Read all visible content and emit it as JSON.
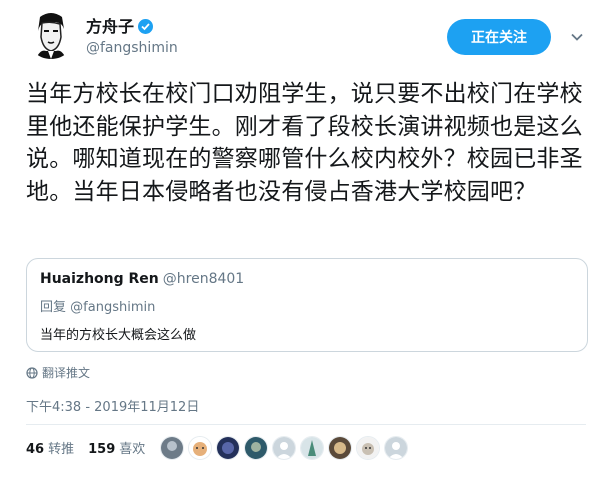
{
  "author": {
    "name": "方舟子",
    "handle": "@fangshimin",
    "verified_color": "#1da1f2"
  },
  "follow_button": {
    "label": "正在关注",
    "color": "#1da1f2"
  },
  "tweet": {
    "text": "当年方校长在校门口劝阻学生，说只要不出校门在学校里他还能保护学生。刚才看了段校长演讲视频也是这么说。哪知道现在的警察哪管什么校内校外？校园已非圣地。当年日本侵略者也没有侵占香港大学校园吧？",
    "translate_label": "翻译推文",
    "timestamp": "下午4:38 - 2019年11月12日"
  },
  "quoted_tweet": {
    "name": "Huaizhong Ren",
    "handle": "@hren8401",
    "reply_prefix": "回复",
    "reply_to": "@fangshimin",
    "text": "当年的方校长大概会这么做"
  },
  "stats": {
    "retweets_count": "46",
    "retweets_label": "转推",
    "likes_count": "159",
    "likes_label": "喜欢"
  },
  "likers": [
    {
      "icon": "avatar-1"
    },
    {
      "icon": "avatar-2"
    },
    {
      "icon": "avatar-3"
    },
    {
      "icon": "avatar-4"
    },
    {
      "icon": "avatar-5"
    },
    {
      "icon": "avatar-6"
    },
    {
      "icon": "avatar-7"
    },
    {
      "icon": "avatar-8"
    },
    {
      "icon": "avatar-9"
    }
  ]
}
